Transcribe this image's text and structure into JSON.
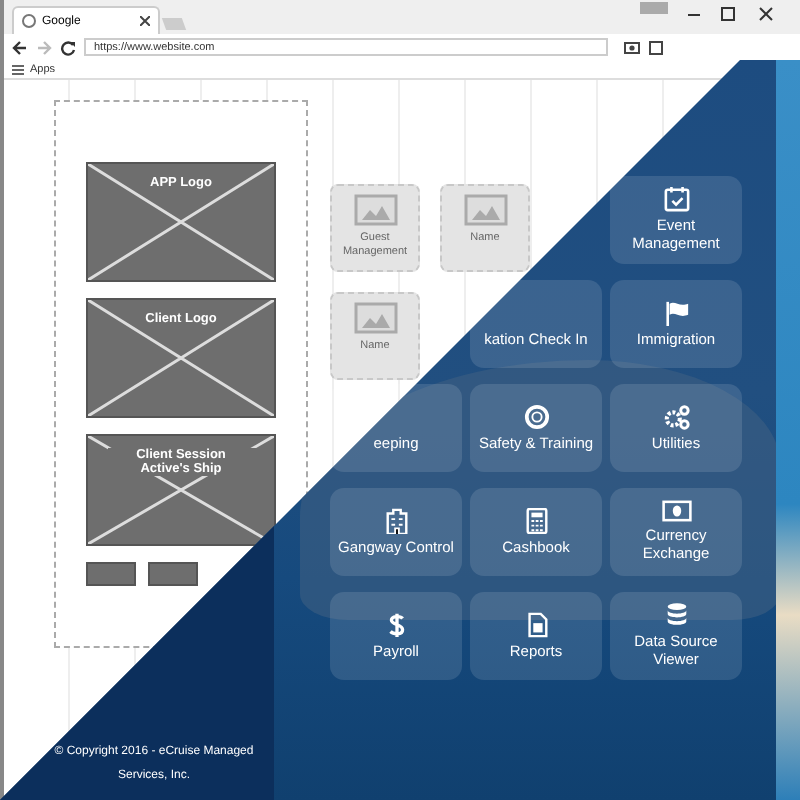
{
  "browser": {
    "tab_title": "Google",
    "url": "https://www.website.com",
    "bookmarks": [
      "Apps"
    ]
  },
  "wireframe": {
    "logos": [
      "APP Logo",
      "Client Logo",
      "Client Session Active's Ship"
    ],
    "tiles": [
      "Guest Management",
      "Name",
      "Name"
    ]
  },
  "design": {
    "tile_rows": [
      [
        {
          "label": "Event Management"
        }
      ],
      [
        {
          "label": "kation Check In"
        },
        {
          "label": "Immigration"
        }
      ],
      [
        {
          "label": "eeping"
        },
        {
          "label": "Safety & Training"
        },
        {
          "label": "Utilities"
        }
      ],
      [
        {
          "label": "Gangway Control"
        },
        {
          "label": "Cashbook"
        },
        {
          "label": "Currency Exchange"
        }
      ],
      [
        {
          "label": "Payroll"
        },
        {
          "label": "Reports"
        },
        {
          "label": "Data Source Viewer"
        }
      ]
    ],
    "copyright": "© Copyright 2016 - eCruise Managed Services, Inc."
  }
}
